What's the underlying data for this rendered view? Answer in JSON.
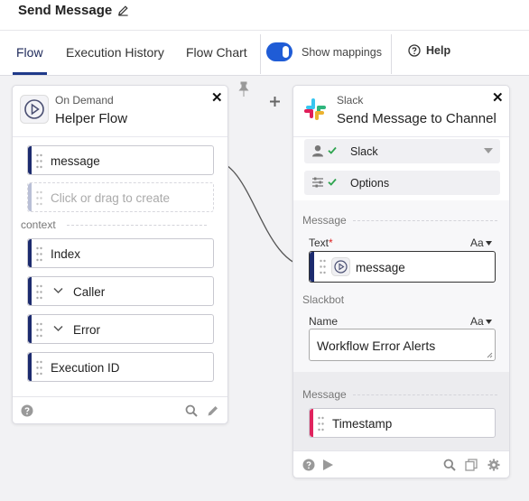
{
  "header": {
    "title": "Send Message"
  },
  "tabs": [
    {
      "label": "Flow",
      "active": true
    },
    {
      "label": "Execution History"
    },
    {
      "label": "Flow Chart"
    }
  ],
  "toolbar": {
    "show_mappings_label": "Show mappings",
    "show_mappings_on": true,
    "help_label": "Help"
  },
  "left_card": {
    "subtitle": "On Demand",
    "title": "Helper Flow",
    "input_field": "message",
    "create_placeholder": "Click or drag to create",
    "context_label": "context",
    "context_items": [
      {
        "label": "Index",
        "expandable": false
      },
      {
        "label": "Caller",
        "expandable": true
      },
      {
        "label": "Error",
        "expandable": true
      },
      {
        "label": "Execution ID",
        "expandable": false
      }
    ]
  },
  "right_card": {
    "subtitle": "Slack",
    "title": "Send Message to Channel",
    "connection_label": "Slack",
    "options_label": "Options",
    "message_section": "Message",
    "text_label": "Text",
    "text_required_mark": "*",
    "text_value": "message",
    "text_format": "Aa",
    "slackbot_section": "Slackbot",
    "name_label": "Name",
    "name_format": "Aa",
    "name_value": "Workflow Error Alerts",
    "message_section_2": "Message",
    "timestamp_label": "Timestamp"
  },
  "colors": {
    "accent": "#1f5cd6",
    "stripe_blue": "#1c2b6e",
    "stripe_pink": "#e0245e"
  }
}
